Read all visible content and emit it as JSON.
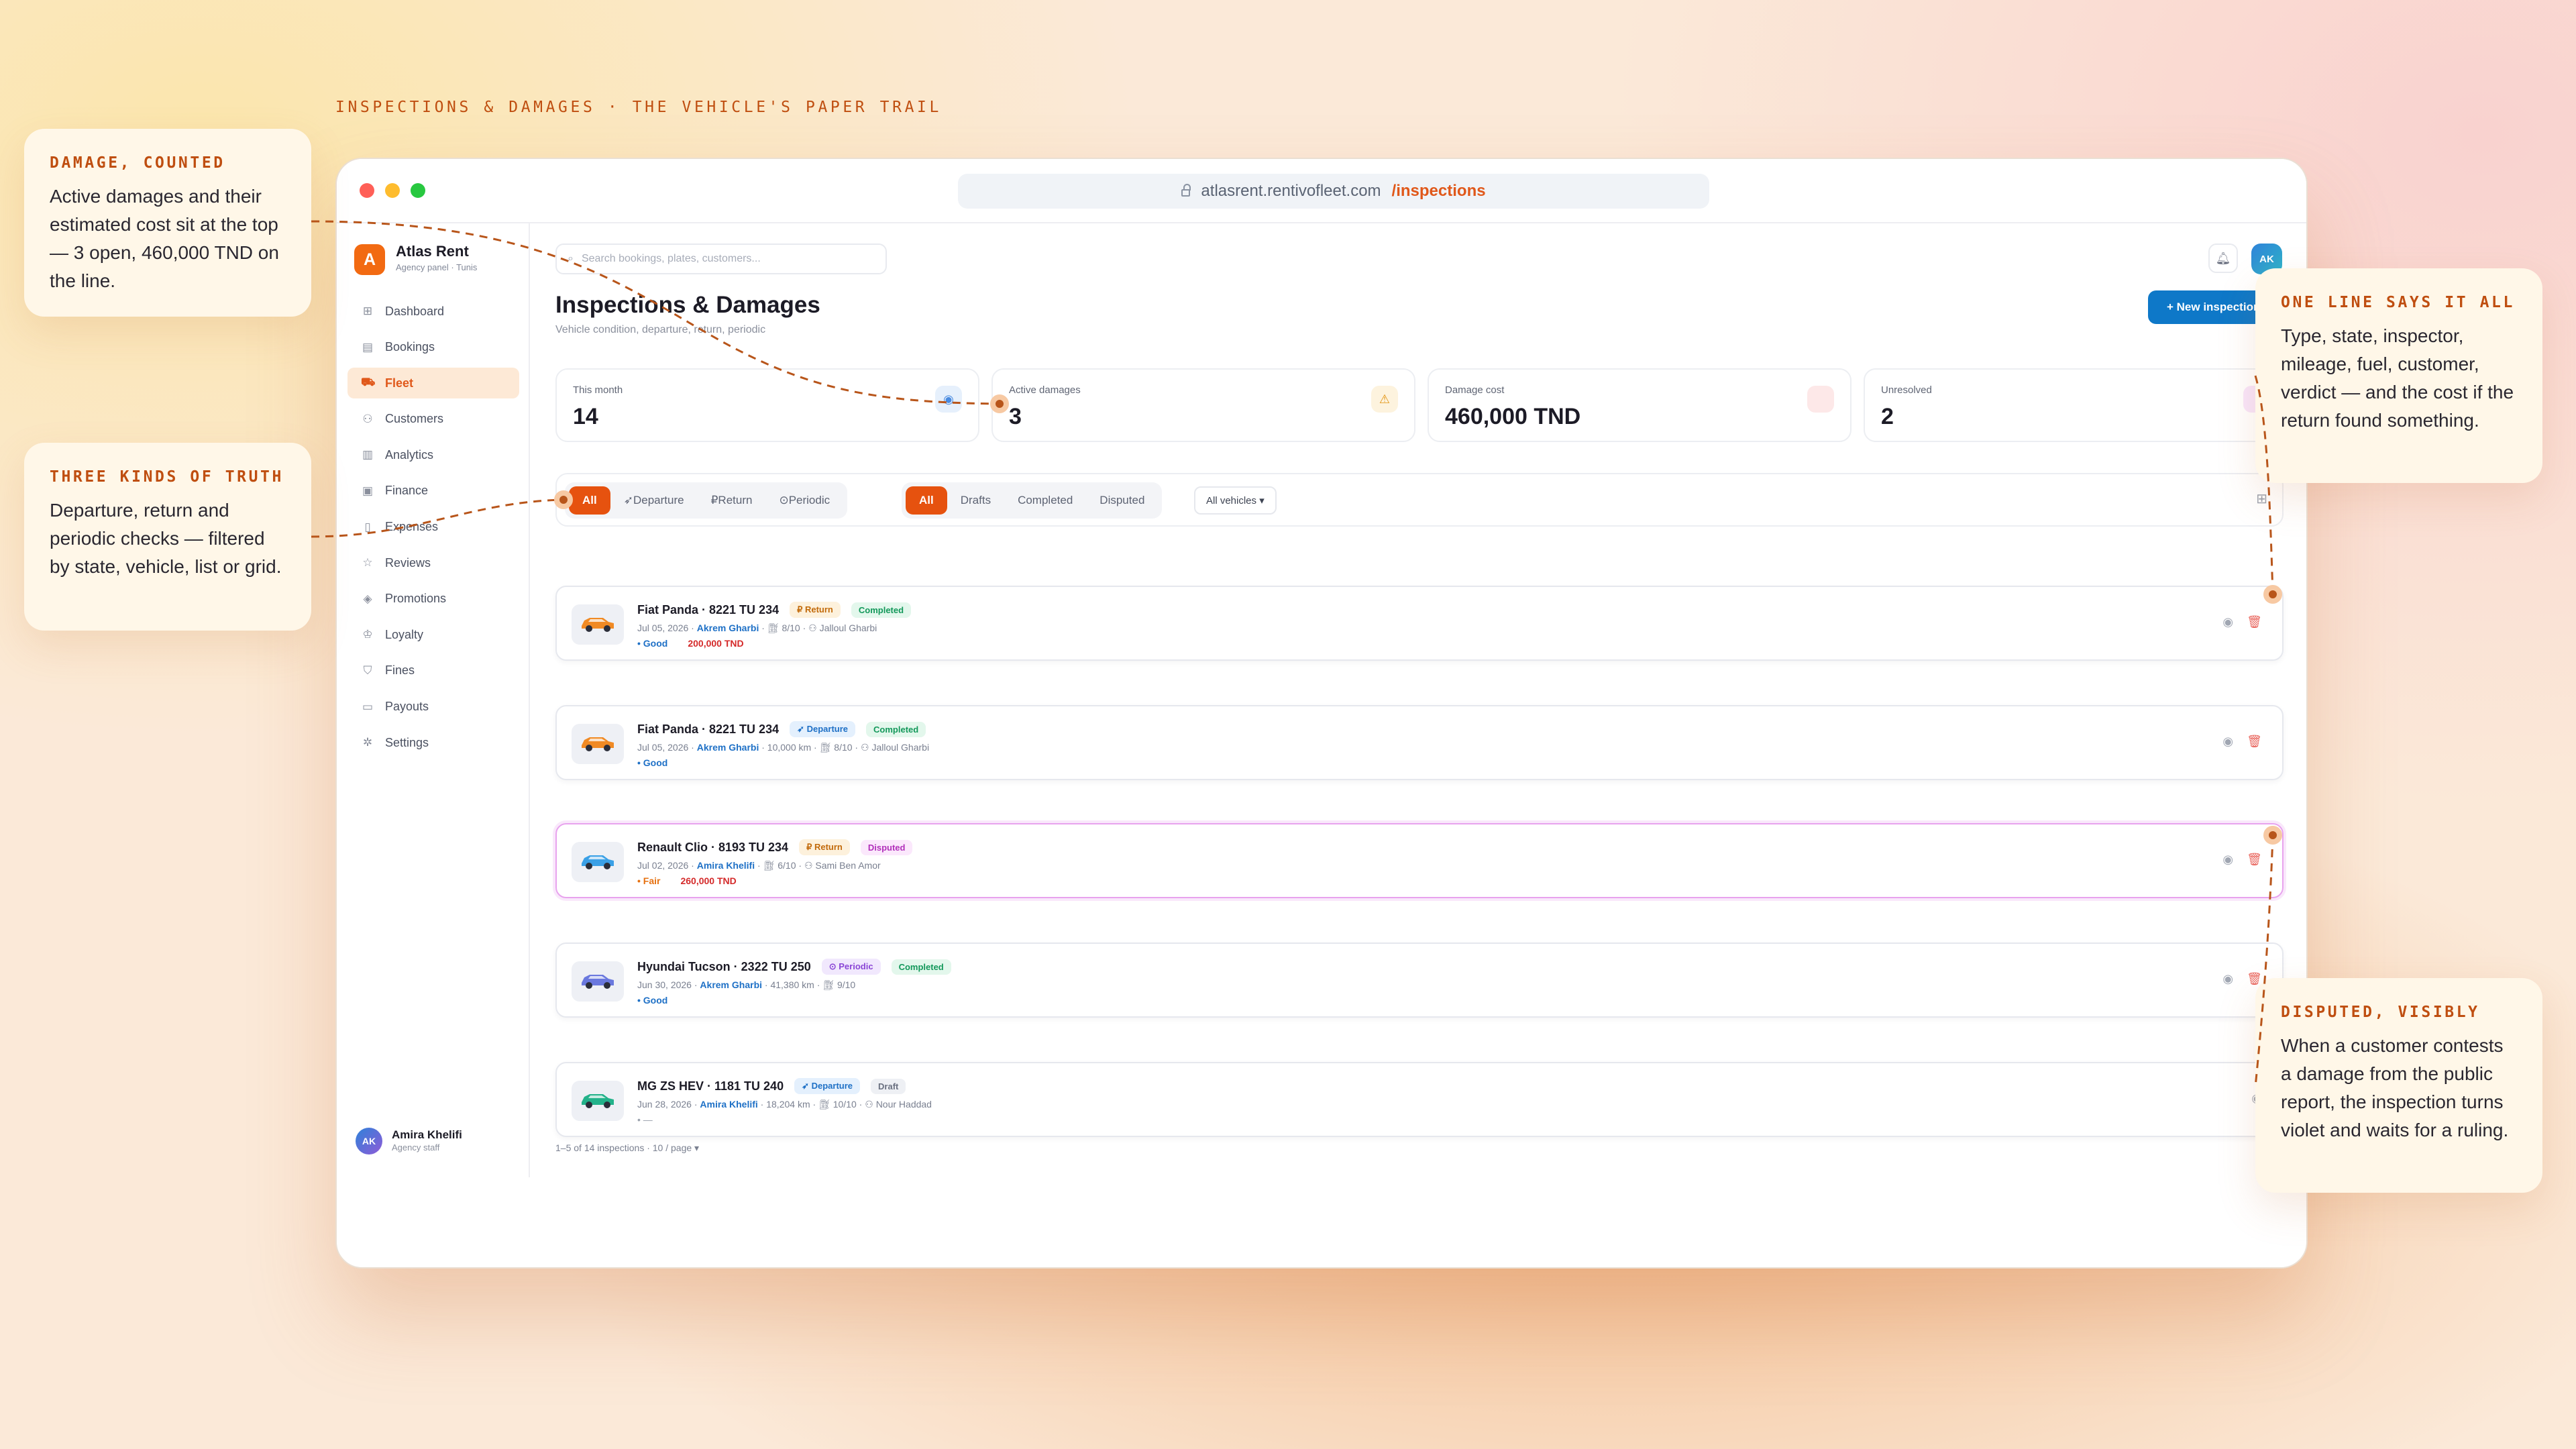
{
  "kicker": "INSPECTIONS & DAMAGES · THE VEHICLE'S PAPER TRAIL",
  "browser": {
    "domain": "atlasrent.rentivofleet.com",
    "path": "/inspections"
  },
  "brand": {
    "logo_letter": "A",
    "name": "Atlas Rent",
    "subtitle": "Agency panel · Tunis"
  },
  "nav": [
    {
      "label": "Dashboard",
      "icon": "grid-icon",
      "glyph": "⊞"
    },
    {
      "label": "Bookings",
      "icon": "calendar-icon",
      "glyph": "▤"
    },
    {
      "label": "Fleet",
      "icon": "car-icon",
      "glyph": "⛟",
      "active": true
    },
    {
      "label": "Customers",
      "icon": "users-icon",
      "glyph": "⚇"
    },
    {
      "label": "Analytics",
      "icon": "chart-icon",
      "glyph": "▥"
    },
    {
      "label": "Finance",
      "icon": "wallet-icon",
      "glyph": "▣"
    },
    {
      "label": "Expenses",
      "icon": "receipt-icon",
      "glyph": "▯"
    },
    {
      "label": "Reviews",
      "icon": "star-icon",
      "glyph": "☆"
    },
    {
      "label": "Promotions",
      "icon": "tag-icon",
      "glyph": "◈"
    },
    {
      "label": "Loyalty",
      "icon": "trophy-icon",
      "glyph": "♔"
    },
    {
      "label": "Fines",
      "icon": "shield-icon",
      "glyph": "⛉"
    },
    {
      "label": "Payouts",
      "icon": "briefcase-icon",
      "glyph": "▭"
    },
    {
      "label": "Settings",
      "icon": "gear-icon",
      "glyph": "✲"
    }
  ],
  "user": {
    "initials": "AK",
    "name": "Amira Khelifi",
    "role": "Agency staff"
  },
  "search": {
    "placeholder": "Search bookings, plates, customers..."
  },
  "topbar": {
    "avatar": "AK"
  },
  "page": {
    "title": "Inspections & Damages",
    "subtitle": "Vehicle condition, departure, return, periodic",
    "new_button": "+ New inspection"
  },
  "stats": [
    {
      "label": "This month",
      "value": "14",
      "icon": "eye-icon",
      "glyph": "◉",
      "color": "#4a8be0",
      "bg": "#e6f0fc"
    },
    {
      "label": "Active damages",
      "value": "3",
      "icon": "warning-icon",
      "glyph": "⚠",
      "color": "#e39410",
      "bg": "#fdf3de"
    },
    {
      "label": "Damage cost",
      "value": "460,000 TND",
      "icon": "cost-icon",
      "glyph": "",
      "color": "#e04848",
      "bg": "#fde8e8"
    },
    {
      "label": "Unresolved",
      "value": "2",
      "icon": "flag-icon",
      "glyph": "",
      "color": "#b12fba",
      "bg": "#f8e5fb"
    }
  ],
  "filters": {
    "type": [
      {
        "label": "All",
        "on": true,
        "glyph": ""
      },
      {
        "label": "Departure",
        "glyph": "➶ "
      },
      {
        "label": "Return",
        "glyph": "₽ "
      },
      {
        "label": "Periodic",
        "glyph": "⊙ "
      }
    ],
    "state": [
      {
        "label": "All",
        "on": true
      },
      {
        "label": "Drafts"
      },
      {
        "label": "Completed"
      },
      {
        "label": "Disputed"
      }
    ],
    "vehicle": "All vehicles ▾"
  },
  "inspections": [
    {
      "vehicle": "Fiat Panda · 8221 TU 234",
      "type": "Return",
      "type_glyph": "₽ ",
      "type_class": "t-ret",
      "status": "Completed",
      "status_class": "t-comp",
      "date": "Jul 05, 2026",
      "customer": "Akrem Gharbi",
      "mileage": "",
      "fuel": "8/10",
      "inspector": "Jalloul Gharbi",
      "verdict": "• Good",
      "verdict_class": "vd-good",
      "cost": "200,000 TND",
      "car_color": "#f08a24"
    },
    {
      "vehicle": "Fiat Panda · 8221 TU 234",
      "type": "Departure",
      "type_glyph": "➶ ",
      "type_class": "t-dep",
      "status": "Completed",
      "status_class": "t-comp",
      "date": "Jul 05, 2026",
      "customer": "Akrem Gharbi",
      "mileage": "10,000 km",
      "fuel": "8/10",
      "inspector": "Jalloul Gharbi",
      "verdict": "• Good",
      "verdict_class": "vd-good",
      "cost": "",
      "car_color": "#f08a24"
    },
    {
      "vehicle": "Renault Clio · 8193 TU 234",
      "type": "Return",
      "type_glyph": "₽ ",
      "type_class": "t-ret",
      "status": "Disputed",
      "status_class": "t-disp",
      "date": "Jul 02, 2026",
      "customer": "Amira Khelifi",
      "mileage": "",
      "fuel": "6/10",
      "inspector": "Sami Ben Amor",
      "verdict": "• Fair",
      "verdict_class": "vd-fair",
      "cost": "260,000 TND",
      "car_color": "#3aa0e6",
      "disputed": true
    },
    {
      "vehicle": "Hyundai Tucson · 2322 TU 250",
      "type": "Periodic",
      "type_glyph": "⊙ ",
      "type_class": "t-per",
      "status": "Completed",
      "status_class": "t-comp",
      "date": "Jun 30, 2026",
      "customer": "Akrem Gharbi",
      "mileage": "41,380 km",
      "fuel": "9/10",
      "inspector": "",
      "verdict": "• Good",
      "verdict_class": "vd-good",
      "cost": "",
      "car_color": "#6a78de"
    },
    {
      "vehicle": "MG ZS HEV · 1181 TU 240",
      "type": "Departure",
      "type_glyph": "➶ ",
      "type_class": "t-dep",
      "status": "Draft",
      "status_class": "t-draft",
      "date": "Jun 28, 2026",
      "customer": "Amira Khelifi",
      "mileage": "18,204 km",
      "fuel": "10/10",
      "inspector": "Nour Haddad",
      "verdict": "• —",
      "verdict_class": "vd-none",
      "cost": "",
      "car_color": "#23b28a",
      "no_trash": true
    }
  ],
  "pagination": "1–5 of 14 inspections · 10 / page ▾",
  "callouts": {
    "damage": {
      "title": "DAMAGE, COUNTED",
      "body": "Active damages and their estimated cost sit at the top — 3 open, 460,000 TND on the line."
    },
    "truth": {
      "title": "THREE KINDS OF TRUTH",
      "body": "Departure, return and periodic checks — filtered by state, vehicle, list or grid."
    },
    "line": {
      "title": "ONE LINE SAYS IT ALL",
      "body": "Type, state, inspector, mileage, fuel, customer, verdict — and the cost if the return found something."
    },
    "disputed": {
      "title": "DISPUTED, VISIBLY",
      "body": "When a customer contests a damage from the public report, the inspection turns violet and waits for a ruling."
    }
  }
}
